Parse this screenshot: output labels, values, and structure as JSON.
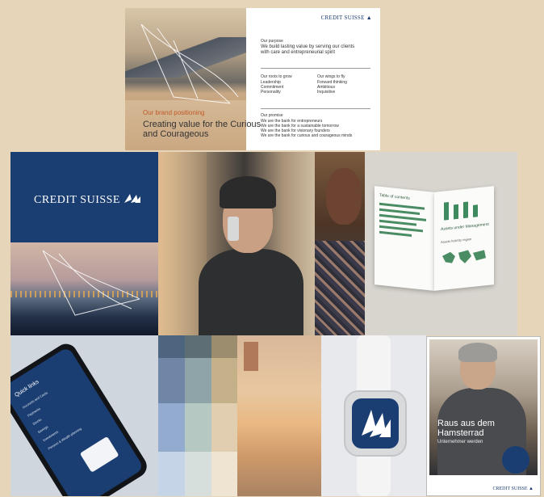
{
  "colors": {
    "background": "#e6d5b8",
    "brand_blue": "#1b3e72",
    "accent_orange": "#c05a2a",
    "chart_green": "#3c8a5e"
  },
  "brand_card": {
    "logo_text": "CREDIT SUISSE",
    "positioning_label": "Our brand positioning",
    "headline": "Creating value for the Curious and Courageous",
    "purpose_label": "Our purpose",
    "purpose_text": "We build lasting value by serving our clients with care and entrepreneurial spirit",
    "roots_label": "Our roots to grow",
    "roots_items": [
      "Leadership",
      "Commitment",
      "Personality"
    ],
    "wings_label": "Our wings to fly",
    "wings_items": [
      "Forward thinking",
      "Ambitious",
      "Inquisitive"
    ],
    "promise_label": "Our promise",
    "promise_lines": [
      "We are the bank for entrepreneurs",
      "We are the bank for a sustainable tomorrow",
      "We are the bank for visionary founders",
      "We are the bank for curious and courageous minds"
    ]
  },
  "poster": {
    "logo_text": "CREDIT SUISSE"
  },
  "phone_app": {
    "title": "Quick links",
    "menu_items": [
      "Accounts and Cards",
      "Payments",
      "Stocks",
      "Savings",
      "Investments",
      "Pension & Wealth planning"
    ]
  },
  "report": {
    "left_title": "Table of contents",
    "right_title": "Assets under Management",
    "map_title": "Assets held by region"
  },
  "palette": {
    "swatches": [
      "#4e6580",
      "#5d6f74",
      "#9c8d6e",
      "#6f86a6",
      "#8fa4a8",
      "#c5b189",
      "#93abcf",
      "#b5c8c2",
      "#e1ceb0",
      "#c5d4e6",
      "#d7dfdc",
      "#efe3d1"
    ]
  },
  "magazine": {
    "title": "Raus aus dem Hamsterrad",
    "subtitle": "Unternehmer werden",
    "logo_text": "CREDIT SUISSE"
  }
}
